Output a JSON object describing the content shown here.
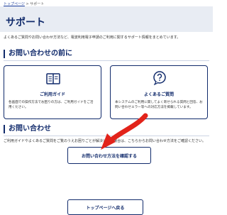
{
  "breadcrumb": {
    "home": "トップページ",
    "separator": " > ",
    "current": "サポート"
  },
  "header": {
    "title": "サポート"
  },
  "intro": {
    "text": "よくあるご質問やお問い合わせ方法など、電波利用電子申請のご利用に関するサポート情報をまとめています。"
  },
  "before_contact": {
    "title": "お問い合わせの前に",
    "cards": [
      {
        "icon": "book-icon",
        "title": "ご利用ガイド",
        "desc": "各画面での操作方法でお困りの方は、ご利用ガイドをご活用ください。"
      },
      {
        "icon": "question-bubble-icon",
        "title": "よくあるご質問",
        "desc": "本システムのご利用に関してよく寄せられる質問と回答、お問い合わせエラー等への対応方法を掲載しています。"
      }
    ]
  },
  "contact": {
    "title": "お問い合わせ",
    "desc": "ご利用ガイドやよくあるご質問をご覧のうえお困りごとが解決しない場合は、こちらからお問い合わせ方法をご確認ください。",
    "confirm_button": "お問い合わせ方法を確認する",
    "top_button": "トップページへ戻る"
  },
  "colors": {
    "accent": "#102a6b",
    "arrow": "#e2231a",
    "header_bg": "#e8ecf3"
  }
}
